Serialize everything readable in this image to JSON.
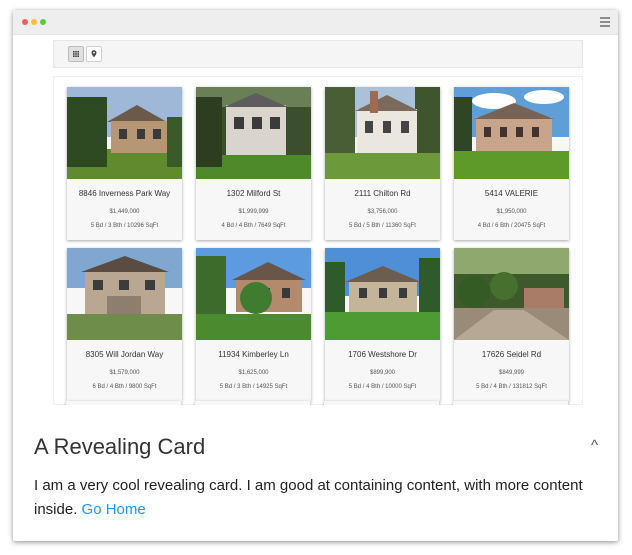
{
  "window": {
    "dots": [
      "#f25f58",
      "#fbbe3c",
      "#58cb42"
    ],
    "menu_icon": "hamburger-icon"
  },
  "toolbar": {
    "grid_view_icon": "grid-icon",
    "map_view_icon": "map-marker-icon"
  },
  "listings": [
    {
      "address": "8846 Inverness Park Way",
      "price": "$1,449,000",
      "details": "5 Bd / 3 Bth / 10296 SqFt"
    },
    {
      "address": "1302 Milford St",
      "price": "$1,999,999",
      "details": "4 Bd / 4 Bth / 7649 SqFt"
    },
    {
      "address": "2111 Chilton Rd",
      "price": "$3,756,000",
      "details": "5 Bd / 5 Bth / 11360 SqFt"
    },
    {
      "address": "5414 VALERIE",
      "price": "$1,950,000",
      "details": "4 Bd / 6 Bth / 20475 SqFt"
    },
    {
      "address": "8305 Will Jordan Way",
      "price": "$1,579,000",
      "details": "6 Bd / 4 Bth / 9800 SqFt"
    },
    {
      "address": "11934 Kimberley Ln",
      "price": "$1,625,000",
      "details": "5 Bd / 3 Bth / 14925 SqFt"
    },
    {
      "address": "1706 Westshore Dr",
      "price": "$899,900",
      "details": "5 Bd / 4 Bth / 10000 SqFt"
    },
    {
      "address": "17626 Seidel Rd",
      "price": "$849,999",
      "details": "5 Bd / 4 Bth / 131812 SqFt"
    }
  ],
  "card": {
    "title": "A Revealing Card",
    "toggle": "^",
    "body_text": "I am a very cool revealing card. I am good at containing content, with more content inside.",
    "link_text": "Go Home",
    "link_color": "#2196f3"
  }
}
